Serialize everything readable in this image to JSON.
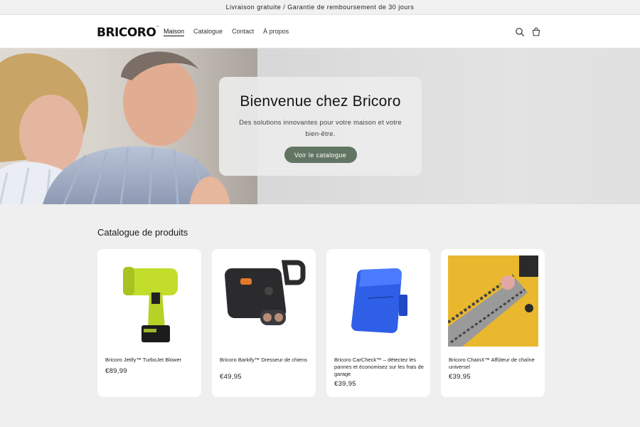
{
  "announcement": "Livraison gratuite / Garantie de remboursement de 30 jours",
  "header": {
    "logo_main": "BRICORO",
    "logo_tm": "™",
    "nav": [
      "Maison",
      "Catalogue",
      "Contact",
      "À propos"
    ],
    "icons": [
      "search-icon",
      "cart-icon"
    ]
  },
  "hero": {
    "title": "Bienvenue chez Bricoro",
    "subtitle": "Des solutions innovantes pour votre maison et votre bien-être.",
    "cta": "Voir le catalogue"
  },
  "catalog": {
    "heading": "Catalogue de produits",
    "products": [
      {
        "title": "Bricoro Jetify™ TurboJet Blower",
        "price": "€89,99"
      },
      {
        "title": "Bricoro Barkify™ Dresseur de chiens",
        "price": "€49,95"
      },
      {
        "title": "Bricoro CarCheck™ – détectez les pannes et économisez sur les frais de garage",
        "price": "€39,95"
      },
      {
        "title": "Bricoro ChainX™ Affûteur de chaîne universel",
        "price": "€39,95"
      }
    ]
  },
  "colors": {
    "accent": "#627563",
    "page_bg": "#efefef",
    "card_bg": "#ffffff"
  }
}
